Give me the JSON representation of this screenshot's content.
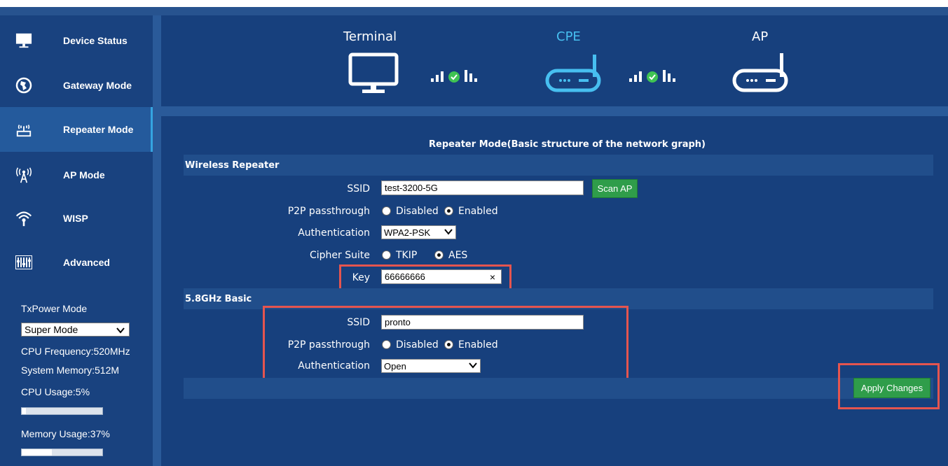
{
  "sidebar": {
    "items": [
      {
        "label": "Device Status",
        "icon": "monitor-icon"
      },
      {
        "label": "Gateway Mode",
        "icon": "globe-icon"
      },
      {
        "label": "Repeater Mode",
        "icon": "router-signal-icon",
        "active": true
      },
      {
        "label": "AP Mode",
        "icon": "antenna-icon"
      },
      {
        "label": "WISP",
        "icon": "wifi-icon"
      },
      {
        "label": "Advanced",
        "icon": "equalizer-icon"
      }
    ],
    "txpower_label": "TxPower Mode",
    "txpower_value": "Super Mode",
    "cpu_frequency": "CPU Frequency:520MHz",
    "system_memory": "System Memory:512M",
    "cpu_usage": "CPU Usage:5%",
    "cpu_usage_percent": 5,
    "memory_usage": "Memory Usage:37%",
    "memory_usage_percent": 37
  },
  "graph": {
    "terminal": "Terminal",
    "cpe": "CPE",
    "ap": "AP"
  },
  "main": {
    "title": "Repeater Mode(Basic structure of the network graph)",
    "wireless_repeater": {
      "title": "Wireless Repeater",
      "ssid_label": "SSID",
      "ssid_value": "test-3200-5G",
      "scan_button": "Scan AP",
      "p2p_label": "P2P passthrough",
      "p2p_disabled": "Disabled",
      "p2p_enabled": "Enabled",
      "auth_label": "Authentication",
      "auth_value": "WPA2-PSK",
      "cipher_label": "Cipher Suite",
      "cipher_tkip": "TKIP",
      "cipher_aes": "AES",
      "key_label": "Key",
      "key_value": "66666666",
      "clear_symbol": "×"
    },
    "basic_58": {
      "title": "5.8GHz Basic",
      "ssid_label": "SSID",
      "ssid_value": "pronto",
      "p2p_label": "P2P passthrough",
      "p2p_disabled": "Disabled",
      "p2p_enabled": "Enabled",
      "auth_label": "Authentication",
      "auth_value": "Open"
    },
    "apply_button": "Apply Changes"
  },
  "colors": {
    "background": "#17407d",
    "accent_cyan": "#47bff0",
    "button_green": "#2f9d4a",
    "highlight_red": "#e5554f"
  }
}
